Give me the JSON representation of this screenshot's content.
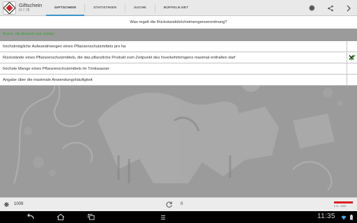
{
  "app": {
    "title": "Giftschein",
    "version": "III 7.78"
  },
  "tabs": [
    {
      "label": "GIFTSCHEIN",
      "active": true
    },
    {
      "label": "STATISTIKEN",
      "active": false
    },
    {
      "label": "SUCHE",
      "active": false
    },
    {
      "label": "BÜFFELN.NET",
      "active": false
    }
  ],
  "toolbar_icons": [
    "settings-icon",
    "share-icon",
    "more-icon"
  ],
  "question": "Was regelt die Rückstandshöchstmengenverordnung?",
  "feedback": "Bravo, die Antwort war richtig!",
  "answers": [
    {
      "text": "höchstmögliche Aufwandmengen eines Pflanzenschutzmittels pro ha",
      "marked": false
    },
    {
      "text": "Rückstände eines Pflanzenschutzmittels, die das pflanzliche Produkt zum Zeitpunkt des Inverkehrbringens maximal enthalten darf",
      "marked": true
    },
    {
      "text": "höchste Menge eines Pflanzenschutzmittels im Trinkwasser",
      "marked": false
    },
    {
      "text": "Angabe über die maximale Anwendungshäufigkeit",
      "marked": false
    }
  ],
  "status": {
    "left_count": "1009",
    "mid_count": "0",
    "progress_text": "0 % - 1009",
    "progress_fraction": 0.98
  },
  "system": {
    "time": "11:35"
  },
  "colors": {
    "tab_indicator": "#3a95c9",
    "feedback_green": "#3aa43a",
    "progress_red": "#dd1f1f"
  }
}
